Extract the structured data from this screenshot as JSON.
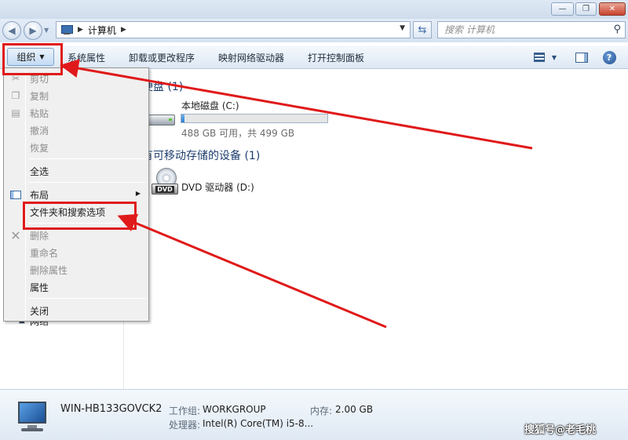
{
  "window": {
    "controls": {
      "minimize": "—",
      "maximize": "❐",
      "close": "✕"
    }
  },
  "address_bar": {
    "breadcrumb": "计算机",
    "search_placeholder": "搜索 计算机"
  },
  "toolbar": {
    "organize_label": "组织",
    "system_properties_label": "系统属性",
    "uninstall_label": "卸载或更改程序",
    "map_drive_label": "映射网络驱动器",
    "control_panel_label": "打开控制面板"
  },
  "content": {
    "hdd_group": "硬盘 (1)",
    "removable_group": "有可移动存储的设备 (1)",
    "drive_c": {
      "name": "本地磁盘 (C:)",
      "free_text": "488 GB 可用，共 499 GB",
      "used_fraction": 0.022
    },
    "drive_d": {
      "name": "DVD 驱动器 (D:)",
      "icon_text": "DVD"
    }
  },
  "menu": {
    "cut": "剪切",
    "copy": "复制",
    "paste": "粘贴",
    "undo": "撤消",
    "redo": "恢复",
    "select_all": "全选",
    "layout": "布局",
    "folder_options": "文件夹和搜索选项",
    "delete": "删除",
    "rename": "重命名",
    "remove_properties": "删除属性",
    "properties": "属性",
    "close": "关闭"
  },
  "navpane": {
    "network_label": "网络"
  },
  "details": {
    "computer_name": "WIN-HB133GOVCK2",
    "workgroup_key": "工作组:",
    "workgroup_val": "WORKGROUP",
    "memory_key": "内存:",
    "memory_val": "2.00 GB",
    "cpu_key": "处理器:",
    "cpu_val": "Intel(R) Core(TM) i5-8..."
  },
  "watermark": "搜狐号@老毛桃",
  "colors": {
    "annotation": "#e01a1a",
    "accent": "#2c7fd4"
  },
  "icons": [
    "back-arrow-icon",
    "forward-arrow-icon",
    "computer-icon",
    "refresh-icon",
    "search-icon",
    "view-icon",
    "preview-pane-icon",
    "help-icon",
    "hard-drive-icon",
    "dvd-drive-icon",
    "network-icon"
  ]
}
